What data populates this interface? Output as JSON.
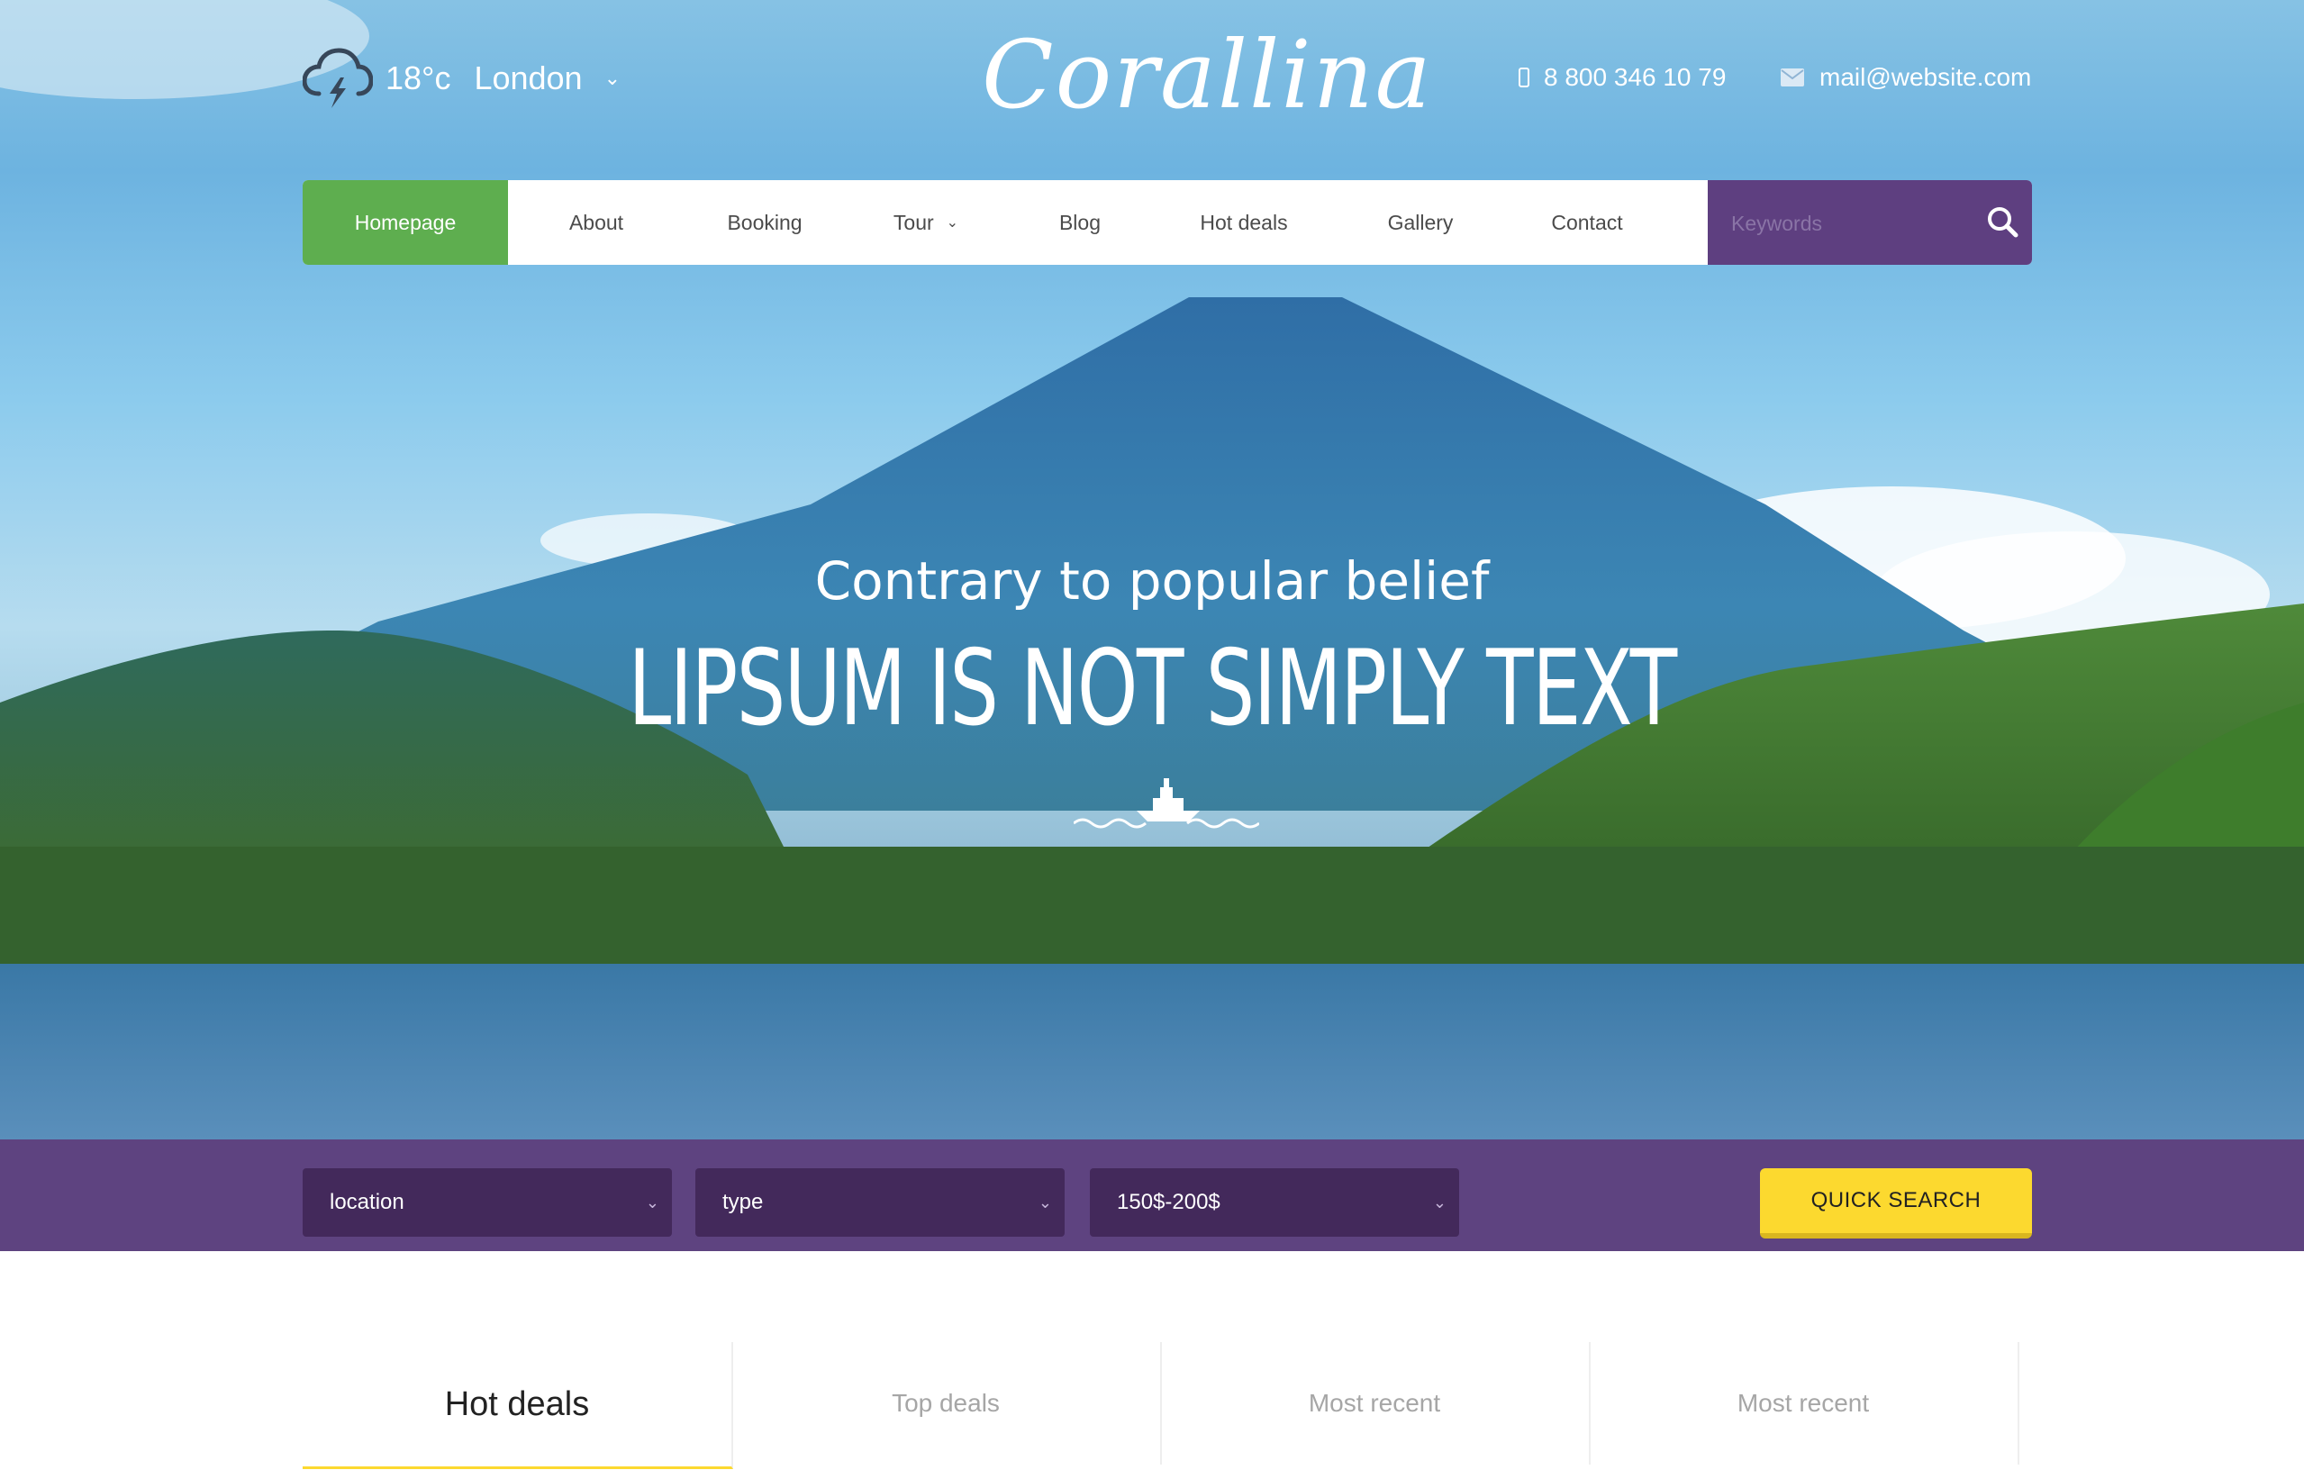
{
  "weather": {
    "temp": "18°c",
    "city": "London"
  },
  "logo": "Corallina",
  "contact": {
    "phone": "8 800 346 10 79",
    "email": "mail@website.com"
  },
  "nav": {
    "items": [
      "Homepage",
      "About",
      "Booking",
      "Tour",
      "Blog",
      "Hot deals",
      "Gallery",
      "Contact"
    ],
    "active": "Homepage",
    "search_placeholder": "Keywords"
  },
  "hero": {
    "subtitle": "Contrary to popular belief",
    "title": "LIPSUM IS NOT SIMPLY TEXT"
  },
  "search": {
    "location": "location",
    "type": "type",
    "price": "150$-200$",
    "button": "QUICK SEARCH"
  },
  "tabs": [
    "Hot deals",
    "Top deals",
    "Most recent",
    "Most recent"
  ],
  "colors": {
    "nav_active": "#5eae4f",
    "purple": "#5e4380",
    "purple_dark": "#43295b",
    "yellow": "#fcd92f"
  }
}
